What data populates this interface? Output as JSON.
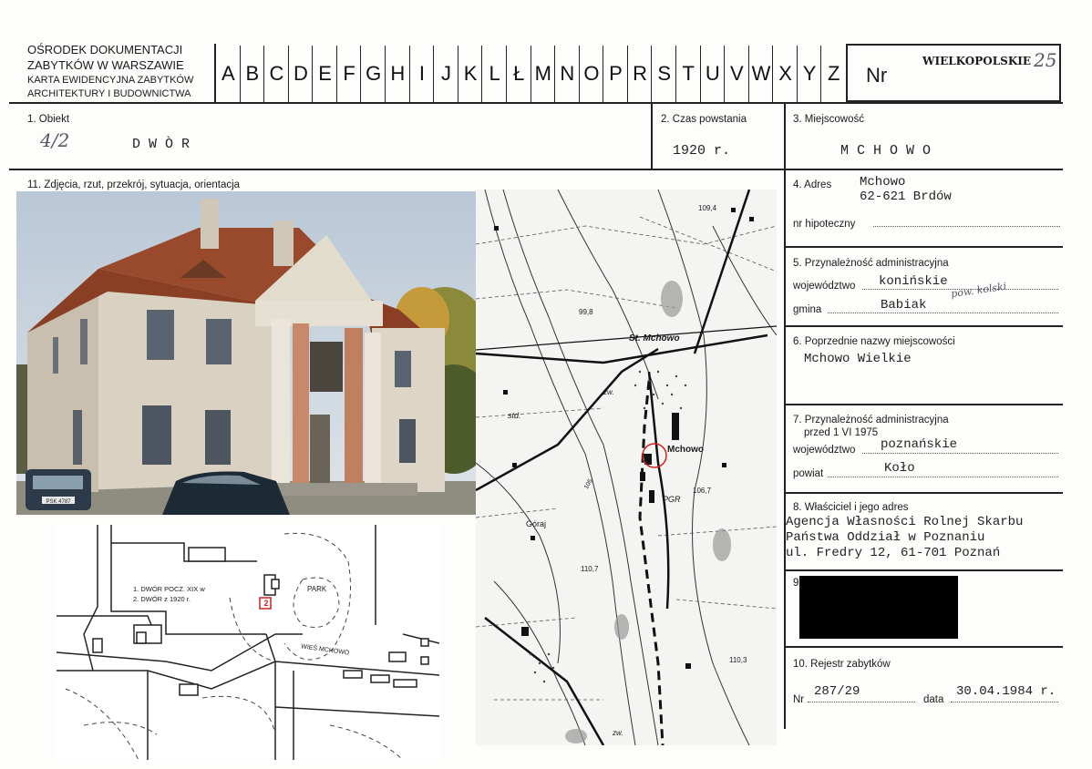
{
  "header": {
    "institution_lines": [
      "OŚRODEK DOKUMENTACJI",
      "ZABYTKÓW W WARSZAWIE",
      "KARTA EWIDENCYJNA ZABYTKÓW",
      "ARCHITEKTURY I BUDOWNICTWA"
    ],
    "alphabet": [
      "A",
      "B",
      "C",
      "D",
      "E",
      "F",
      "G",
      "H",
      "I",
      "J",
      "K",
      "L",
      "Ł",
      "M",
      "N",
      "O",
      "P",
      "R",
      "S",
      "T",
      "U",
      "V",
      "W",
      "X",
      "Y",
      "Z"
    ],
    "nr_label": "Nr",
    "nr_value": "WIELKOPOLSKIE",
    "nr_hand": "25"
  },
  "obiekt": {
    "label": "1. Obiekt",
    "hand": "4/2",
    "value": "D W Ò R"
  },
  "czas": {
    "label": "2. Czas powstania",
    "value": "1920 r."
  },
  "miejscowosc": {
    "label": "3. Miejscowość",
    "value": "M C H O W O"
  },
  "adres": {
    "label": "4. Adres",
    "line1": "Mchowo",
    "line2": "62-621 Brdów",
    "hipoteczny_label": "nr hipoteczny"
  },
  "przynaleznosc": {
    "label": "5. Przynależność administracyjna",
    "woj_label": "województwo",
    "woj_value": "konińskie",
    "gmina_label": "gmina",
    "gmina_value": "Babiak",
    "gmina_hand": "pow. kolski"
  },
  "poprzednie": {
    "label": "6. Poprzednie nazwy miejscowości",
    "value": "Mchowo Wielkie"
  },
  "przed1975": {
    "label": "7. Przynależność administracyjna",
    "sublabel": "przed 1 VI 1975",
    "woj_label": "województwo",
    "woj_value": "poznańskie",
    "powiat_label": "powiat",
    "powiat_value": "Koło"
  },
  "wlasciciel": {
    "label": "8. Właściciel i jego adres",
    "line1": "Agencja Własności Rolnej Skarbu",
    "line2": "Państwa Oddział w Poznaniu",
    "line3": "ul. Fredry 12, 61-701 Poznań",
    "redacted_char": "9"
  },
  "rejestr": {
    "label": "10. Rejestr zabytków",
    "nr_label": "Nr",
    "nr_value": "287/29",
    "data_label": "data",
    "data_value": "30.04.1984 r."
  },
  "zdjecia": {
    "label": "11. Zdjęcia, rzut, przekrój, sytuacja, orientacja"
  },
  "photo": {
    "car_plate": "PSK 4787"
  },
  "sketch": {
    "legend1": "1. DWÓR POCZ. XIX w",
    "legend2": "2. DWÓR z 1920 r.",
    "park": "PARK",
    "village": "WIEŚ MCHOWO",
    "marker": "2"
  },
  "map": {
    "labels": {
      "h1094": "109,4",
      "h998": "99,8",
      "st_mchowo": "St. Mchowo",
      "zw1": "zw.",
      "std": "std.",
      "mchowo": "Mchowo",
      "h1067": "106,7",
      "pgr": "PGR",
      "goraj": "Góraj",
      "h1107": "110,7",
      "h1103": "110,3",
      "h105": "105",
      "zw2": "zw."
    }
  },
  "colors": {
    "ink": "#222222",
    "paper": "#fdfdfb",
    "roof": "#9a4a2c",
    "wall": "#ddd6c6",
    "sky": "#c7d3df",
    "redacted": "#000000",
    "circle": "#d02020"
  }
}
